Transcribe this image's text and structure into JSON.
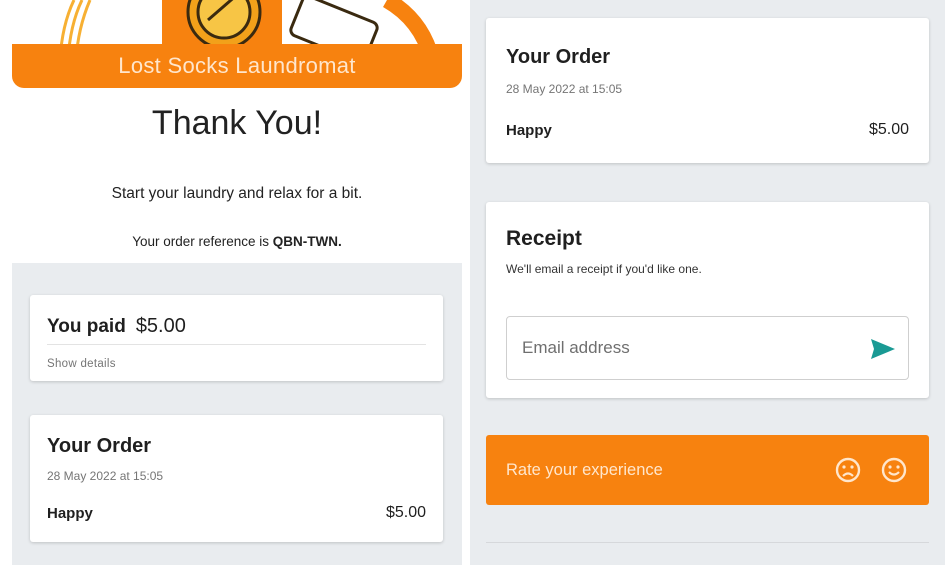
{
  "brand": {
    "name": "Lost Socks Laundromat",
    "accent_color": "#f7820f"
  },
  "confirmation": {
    "heading": "Thank You!",
    "message": "Start your laundry and relax for a bit.",
    "reference_prefix": "Your order reference is",
    "reference_code": "QBN-TWN."
  },
  "payment": {
    "label": "You paid",
    "amount": "$5.00",
    "details_link": "Show details"
  },
  "order": {
    "title": "Your Order",
    "date": "28 May 2022 at 15:05",
    "items": [
      {
        "name": "Happy",
        "price": "$5.00"
      }
    ]
  },
  "receipt": {
    "title": "Receipt",
    "subtitle": "We'll email a receipt if you'd like one.",
    "email_placeholder": "Email address",
    "email_value": "",
    "send_icon": "send-icon"
  },
  "rating": {
    "label": "Rate your experience",
    "icons": [
      "sad-face-icon",
      "happy-face-icon"
    ]
  }
}
